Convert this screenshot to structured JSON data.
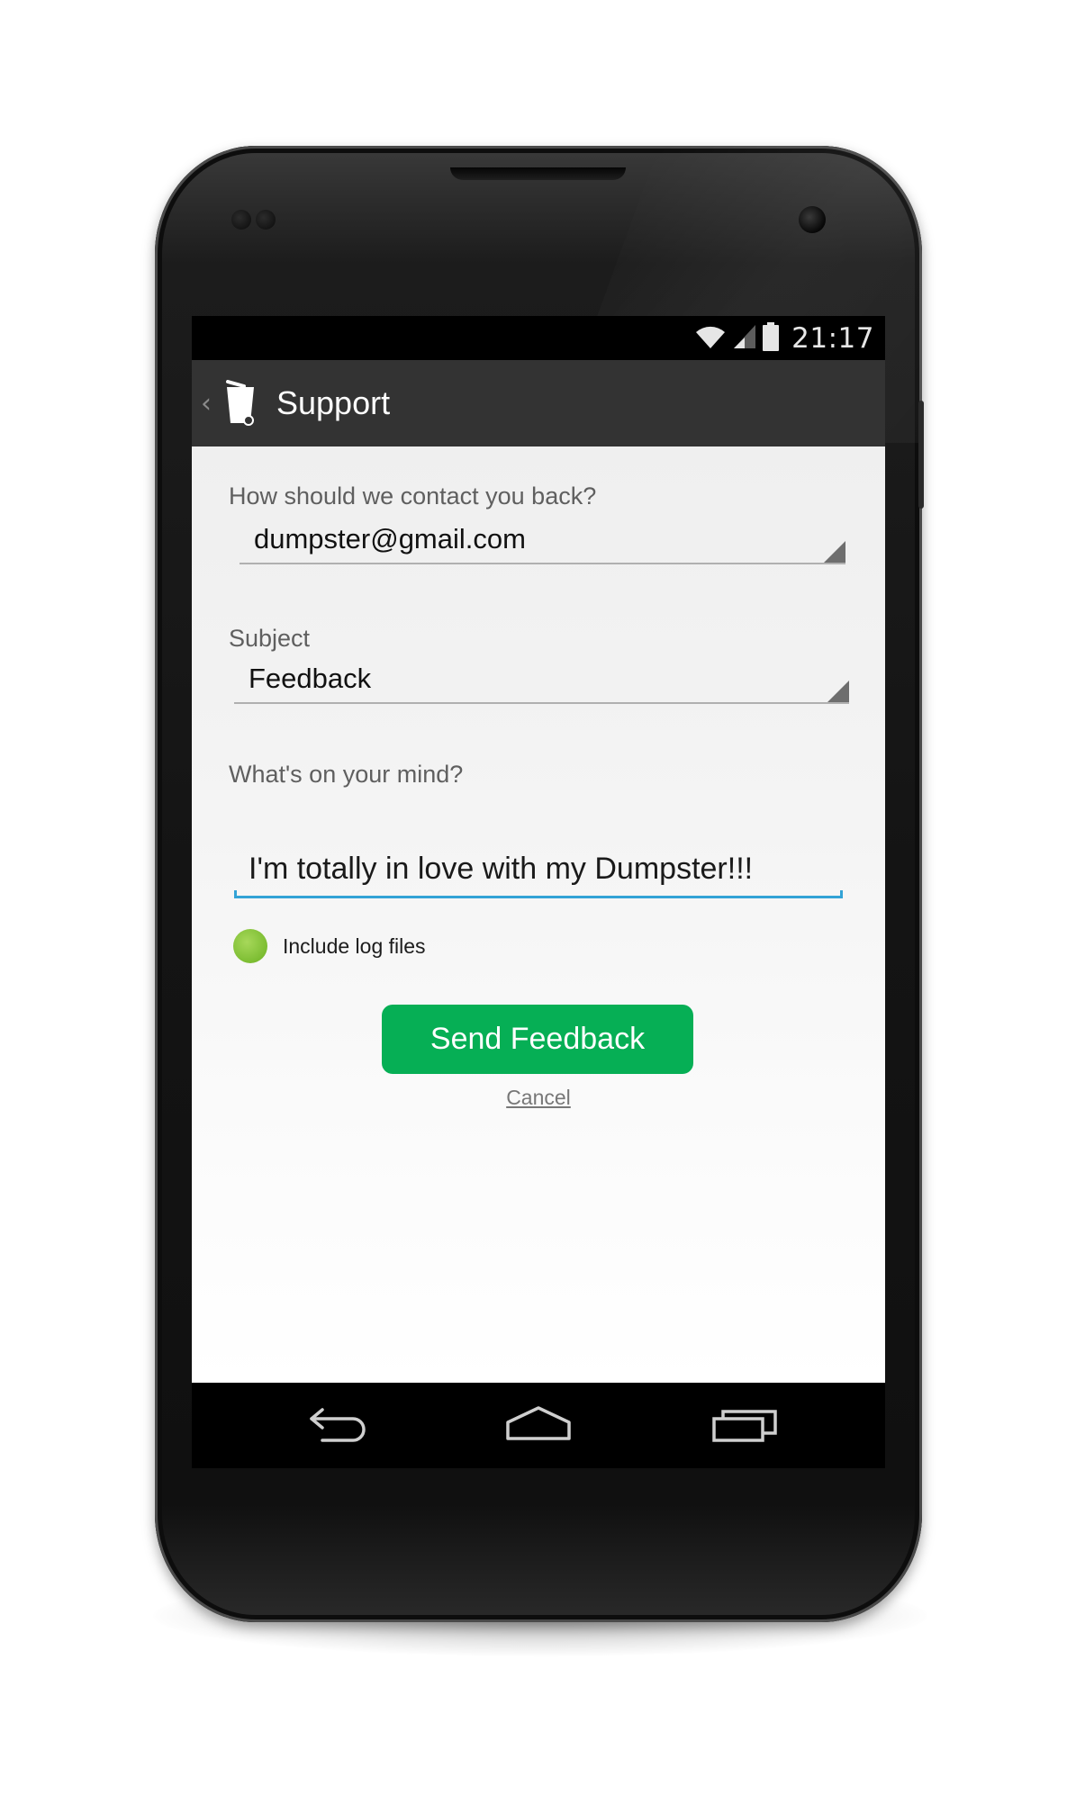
{
  "status_bar": {
    "time": "21:17",
    "icons": [
      "wifi-icon",
      "signal-icon",
      "battery-icon"
    ]
  },
  "action_bar": {
    "up_icon": "chevron-left-icon",
    "app_icon": "trash-bin-icon",
    "title": "Support"
  },
  "form": {
    "contact_label": "How should we contact you back?",
    "contact_value": "dumpster@gmail.com",
    "subject_label": "Subject",
    "subject_value": "Feedback",
    "message_label": "What's on your mind?",
    "message_value": "I'm totally in love with my Dumpster!!!",
    "include_logs_label": "Include log files",
    "include_logs_checked": true,
    "send_button_label": "Send Feedback",
    "cancel_label": "Cancel"
  },
  "nav_bar": {
    "back_icon": "back-icon",
    "home_icon": "home-icon",
    "recents_icon": "recents-icon"
  },
  "colors": {
    "accent_green": "#06af55",
    "checkbox_green": "#7cbd32",
    "input_focus_blue": "#33a3d6",
    "action_bar_bg": "#333333"
  }
}
